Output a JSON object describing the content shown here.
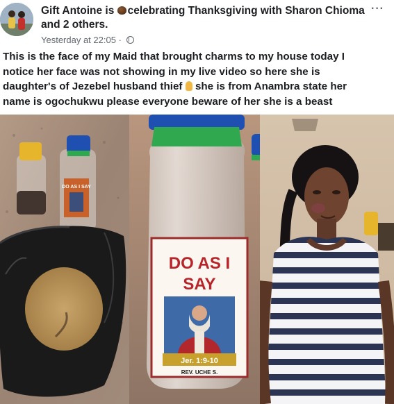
{
  "post": {
    "author": "Gift Antoine",
    "is_text": "is",
    "activity": "celebrating Thanksgiving with",
    "tagged": "Sharon Chioma",
    "and_text": "and",
    "others": "2 others.",
    "timestamp": "Yesterday at 22:05",
    "separator": "·",
    "more_label": "···",
    "icons": {
      "activity": "thanksgiving-emoji-icon",
      "privacy": "globe-icon",
      "inline": "pointing-hand-icon"
    },
    "text_lines": [
      "This is the face of my Maid that brought charms to my house today I",
      "notice her face was not showing in my live video so here she is",
      "daughter's of Jezebel husband thief",
      "she is from Anambra state her",
      "name is ogochukwu please everyone beware of her she is a beast"
    ]
  },
  "photos": {
    "bottle_small_label": "DO AS I SAY",
    "label_line1": "DO AS I",
    "label_line2": "SAY",
    "label_ref": "Jer. 1:9-10",
    "label_sign": "REV. UCHE S."
  },
  "colors": {
    "text": "#1c1e21",
    "meta": "#606770",
    "cap_green": "#2fa84f",
    "cap_blue": "#1f4fb0",
    "cap_yellow": "#e7b52c"
  }
}
